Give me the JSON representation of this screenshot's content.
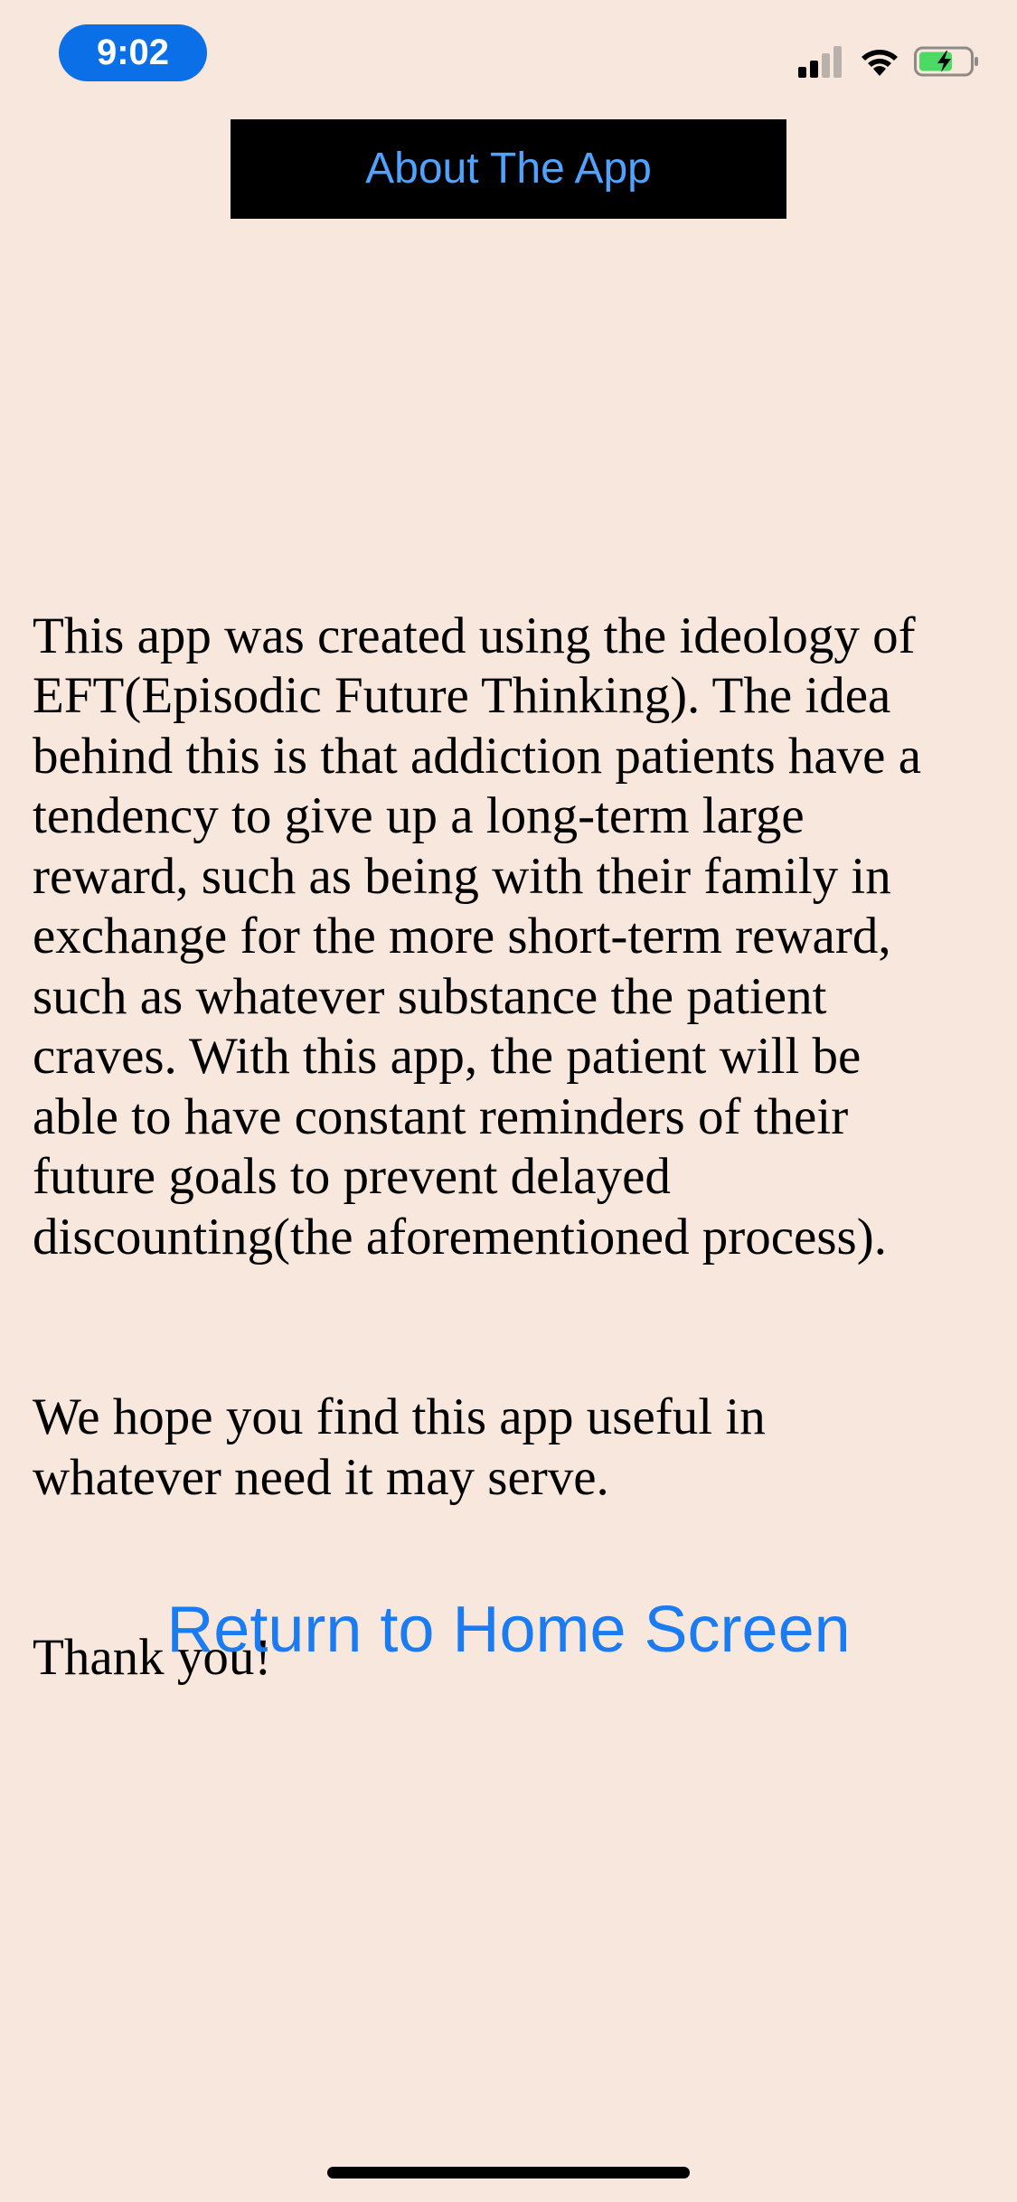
{
  "status_bar": {
    "time": "9:02",
    "icons": [
      "cellular-signal-icon",
      "wifi-icon",
      "battery-charging-icon"
    ],
    "time_pill_color": "#0b6fe8",
    "battery_fill_color": "#4cd964"
  },
  "header": {
    "title": "About The App",
    "title_color": "#4fa3ff",
    "background": "#000000"
  },
  "content": {
    "paragraphs": [
      "This app was created using the ideology of\nEFT(Episodic Future Thinking). The idea\nbehind this is that addiction patients have a\ntendency to give up a long-term large\nreward, such as being  with their family in\nexchange for the more short-term reward,\nsuch as whatever substance the patient\ncraves. With this app, the  patient will be\nable to have constant reminders of their\nfuture goals to prevent delayed\ndiscounting(the aforementioned process).",
      "We hope you find this app useful in\nwhatever need it may serve.",
      "Thank you!"
    ]
  },
  "actions": {
    "return_label": "Return to Home Screen",
    "link_color": "#1a7cf0"
  },
  "page": {
    "background": "#f8e7dd"
  }
}
